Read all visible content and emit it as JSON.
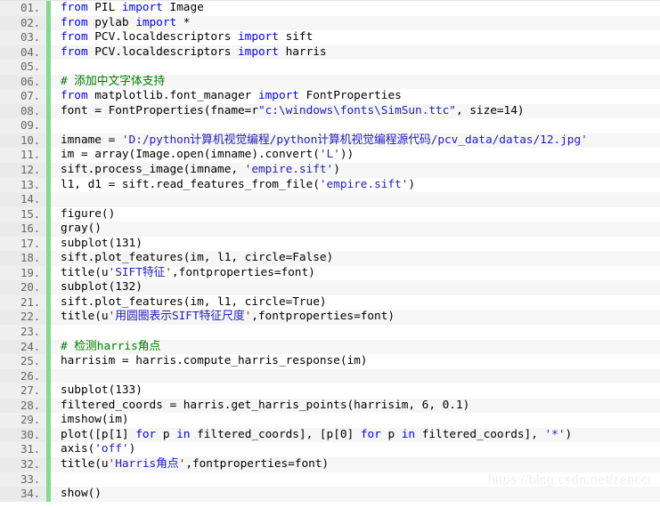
{
  "editor": {
    "title": "python-code-listing",
    "language": "python",
    "line_number_suffix": ".",
    "total_lines": 34,
    "colors": {
      "background": "#ffffff",
      "alt_row_background": "#f6f6f6",
      "gutter_background": "#efefef",
      "gutter_text": "#666666",
      "gutter_accent_bar": "#7fdc8c",
      "keyword": "#0000ff",
      "comment": "#008000",
      "string": "#2020c0",
      "quote": "#a31515",
      "plain_text": "#000000",
      "watermark": "#f0f0f0"
    }
  },
  "watermark": {
    "text": "https://blog.csdn.net/zencci"
  },
  "lines": [
    {
      "num": "01.",
      "tokens": [
        {
          "t": "from",
          "c": "kw"
        },
        {
          "t": " PIL ",
          "c": "pln"
        },
        {
          "t": "import",
          "c": "kw"
        },
        {
          "t": " Image",
          "c": "pln"
        }
      ]
    },
    {
      "num": "02.",
      "tokens": [
        {
          "t": "from",
          "c": "kw"
        },
        {
          "t": " pylab ",
          "c": "pln"
        },
        {
          "t": "import",
          "c": "kw"
        },
        {
          "t": " *",
          "c": "pln"
        }
      ]
    },
    {
      "num": "03.",
      "tokens": [
        {
          "t": "from",
          "c": "kw"
        },
        {
          "t": " PCV.localdescriptors ",
          "c": "pln"
        },
        {
          "t": "import",
          "c": "kw"
        },
        {
          "t": " sift",
          "c": "pln"
        }
      ]
    },
    {
      "num": "04.",
      "tokens": [
        {
          "t": "from",
          "c": "kw"
        },
        {
          "t": " PCV.localdescriptors ",
          "c": "pln"
        },
        {
          "t": "import",
          "c": "kw"
        },
        {
          "t": " harris",
          "c": "pln"
        }
      ]
    },
    {
      "num": "05.",
      "tokens": []
    },
    {
      "num": "06.",
      "tokens": [
        {
          "t": "# 添加中文字体支持",
          "c": "com"
        }
      ]
    },
    {
      "num": "07.",
      "tokens": [
        {
          "t": "from",
          "c": "kw"
        },
        {
          "t": " matplotlib.font_manager ",
          "c": "pln"
        },
        {
          "t": "import",
          "c": "kw"
        },
        {
          "t": " FontProperties",
          "c": "pln"
        }
      ]
    },
    {
      "num": "08.",
      "tokens": [
        {
          "t": "font = FontProperties(fname=r",
          "c": "pln"
        },
        {
          "t": "\"c:\\windows\\fonts\\SimSun.ttc\"",
          "c": "str"
        },
        {
          "t": ", size=14)",
          "c": "pln"
        }
      ]
    },
    {
      "num": "09.",
      "tokens": []
    },
    {
      "num": "10.",
      "tokens": [
        {
          "t": "imname = ",
          "c": "pln"
        },
        {
          "t": "'D:/python计算机视觉编程/python计算机视觉编程源代码/pcv_data/datas/12.jpg'",
          "c": "str"
        }
      ]
    },
    {
      "num": "11.",
      "tokens": [
        {
          "t": "im = array(Image.open(imname).convert(",
          "c": "pln"
        },
        {
          "t": "'L'",
          "c": "str"
        },
        {
          "t": "))",
          "c": "pln"
        }
      ]
    },
    {
      "num": "12.",
      "tokens": [
        {
          "t": "sift.process_image(imname, ",
          "c": "pln"
        },
        {
          "t": "'empire.sift'",
          "c": "str"
        },
        {
          "t": ")",
          "c": "pln"
        }
      ]
    },
    {
      "num": "13.",
      "tokens": [
        {
          "t": "l1, d1 = sift.read_features_from_file(",
          "c": "pln"
        },
        {
          "t": "'empire.sift'",
          "c": "str"
        },
        {
          "t": ")",
          "c": "pln"
        }
      ]
    },
    {
      "num": "14.",
      "tokens": []
    },
    {
      "num": "15.",
      "tokens": [
        {
          "t": "figure()",
          "c": "pln"
        }
      ]
    },
    {
      "num": "16.",
      "tokens": [
        {
          "t": "gray()",
          "c": "pln"
        }
      ]
    },
    {
      "num": "17.",
      "tokens": [
        {
          "t": "subplot(131)",
          "c": "pln"
        }
      ]
    },
    {
      "num": "18.",
      "tokens": [
        {
          "t": "sift.plot_features(im, l1, circle=False)",
          "c": "pln"
        }
      ]
    },
    {
      "num": "19.",
      "tokens": [
        {
          "t": "title(u",
          "c": "pln"
        },
        {
          "t": "'",
          "c": "q"
        },
        {
          "t": "SIFT特征",
          "c": "str"
        },
        {
          "t": "'",
          "c": "q"
        },
        {
          "t": ",fontproperties=font)",
          "c": "pln"
        }
      ]
    },
    {
      "num": "20.",
      "tokens": [
        {
          "t": "subplot(132)",
          "c": "pln"
        }
      ]
    },
    {
      "num": "21.",
      "tokens": [
        {
          "t": "sift.plot_features(im, l1, circle=True)",
          "c": "pln"
        }
      ]
    },
    {
      "num": "22.",
      "tokens": [
        {
          "t": "title(u",
          "c": "pln"
        },
        {
          "t": "'",
          "c": "q"
        },
        {
          "t": "用圆圈表示SIFT特征尺度",
          "c": "str"
        },
        {
          "t": "'",
          "c": "q"
        },
        {
          "t": ",fontproperties=font)",
          "c": "pln"
        }
      ]
    },
    {
      "num": "23.",
      "tokens": []
    },
    {
      "num": "24.",
      "tokens": [
        {
          "t": "# 检测harris角点",
          "c": "com"
        }
      ]
    },
    {
      "num": "25.",
      "tokens": [
        {
          "t": "harrisim = harris.compute_harris_response(im)",
          "c": "pln"
        }
      ]
    },
    {
      "num": "26.",
      "tokens": []
    },
    {
      "num": "27.",
      "tokens": [
        {
          "t": "subplot(133)",
          "c": "pln"
        }
      ]
    },
    {
      "num": "28.",
      "tokens": [
        {
          "t": "filtered_coords = harris.get_harris_points(harrisim, 6, 0.1)",
          "c": "pln"
        }
      ]
    },
    {
      "num": "29.",
      "tokens": [
        {
          "t": "imshow(im)",
          "c": "pln"
        }
      ]
    },
    {
      "num": "30.",
      "tokens": [
        {
          "t": "plot([p[1] ",
          "c": "pln"
        },
        {
          "t": "for",
          "c": "kw"
        },
        {
          "t": " p ",
          "c": "pln"
        },
        {
          "t": "in",
          "c": "kw"
        },
        {
          "t": " filtered_coords], [p[0] ",
          "c": "pln"
        },
        {
          "t": "for",
          "c": "kw"
        },
        {
          "t": " p ",
          "c": "pln"
        },
        {
          "t": "in",
          "c": "kw"
        },
        {
          "t": " filtered_coords], ",
          "c": "pln"
        },
        {
          "t": "'*'",
          "c": "str"
        },
        {
          "t": ")",
          "c": "pln"
        }
      ]
    },
    {
      "num": "31.",
      "tokens": [
        {
          "t": "axis(",
          "c": "pln"
        },
        {
          "t": "'off'",
          "c": "str"
        },
        {
          "t": ")",
          "c": "pln"
        }
      ]
    },
    {
      "num": "32.",
      "tokens": [
        {
          "t": "title(u",
          "c": "pln"
        },
        {
          "t": "'",
          "c": "q"
        },
        {
          "t": "Harris角点",
          "c": "str"
        },
        {
          "t": "'",
          "c": "q"
        },
        {
          "t": ",fontproperties=font)",
          "c": "pln"
        }
      ]
    },
    {
      "num": "33.",
      "tokens": []
    },
    {
      "num": "34.",
      "tokens": [
        {
          "t": "show()",
          "c": "pln"
        }
      ]
    }
  ]
}
